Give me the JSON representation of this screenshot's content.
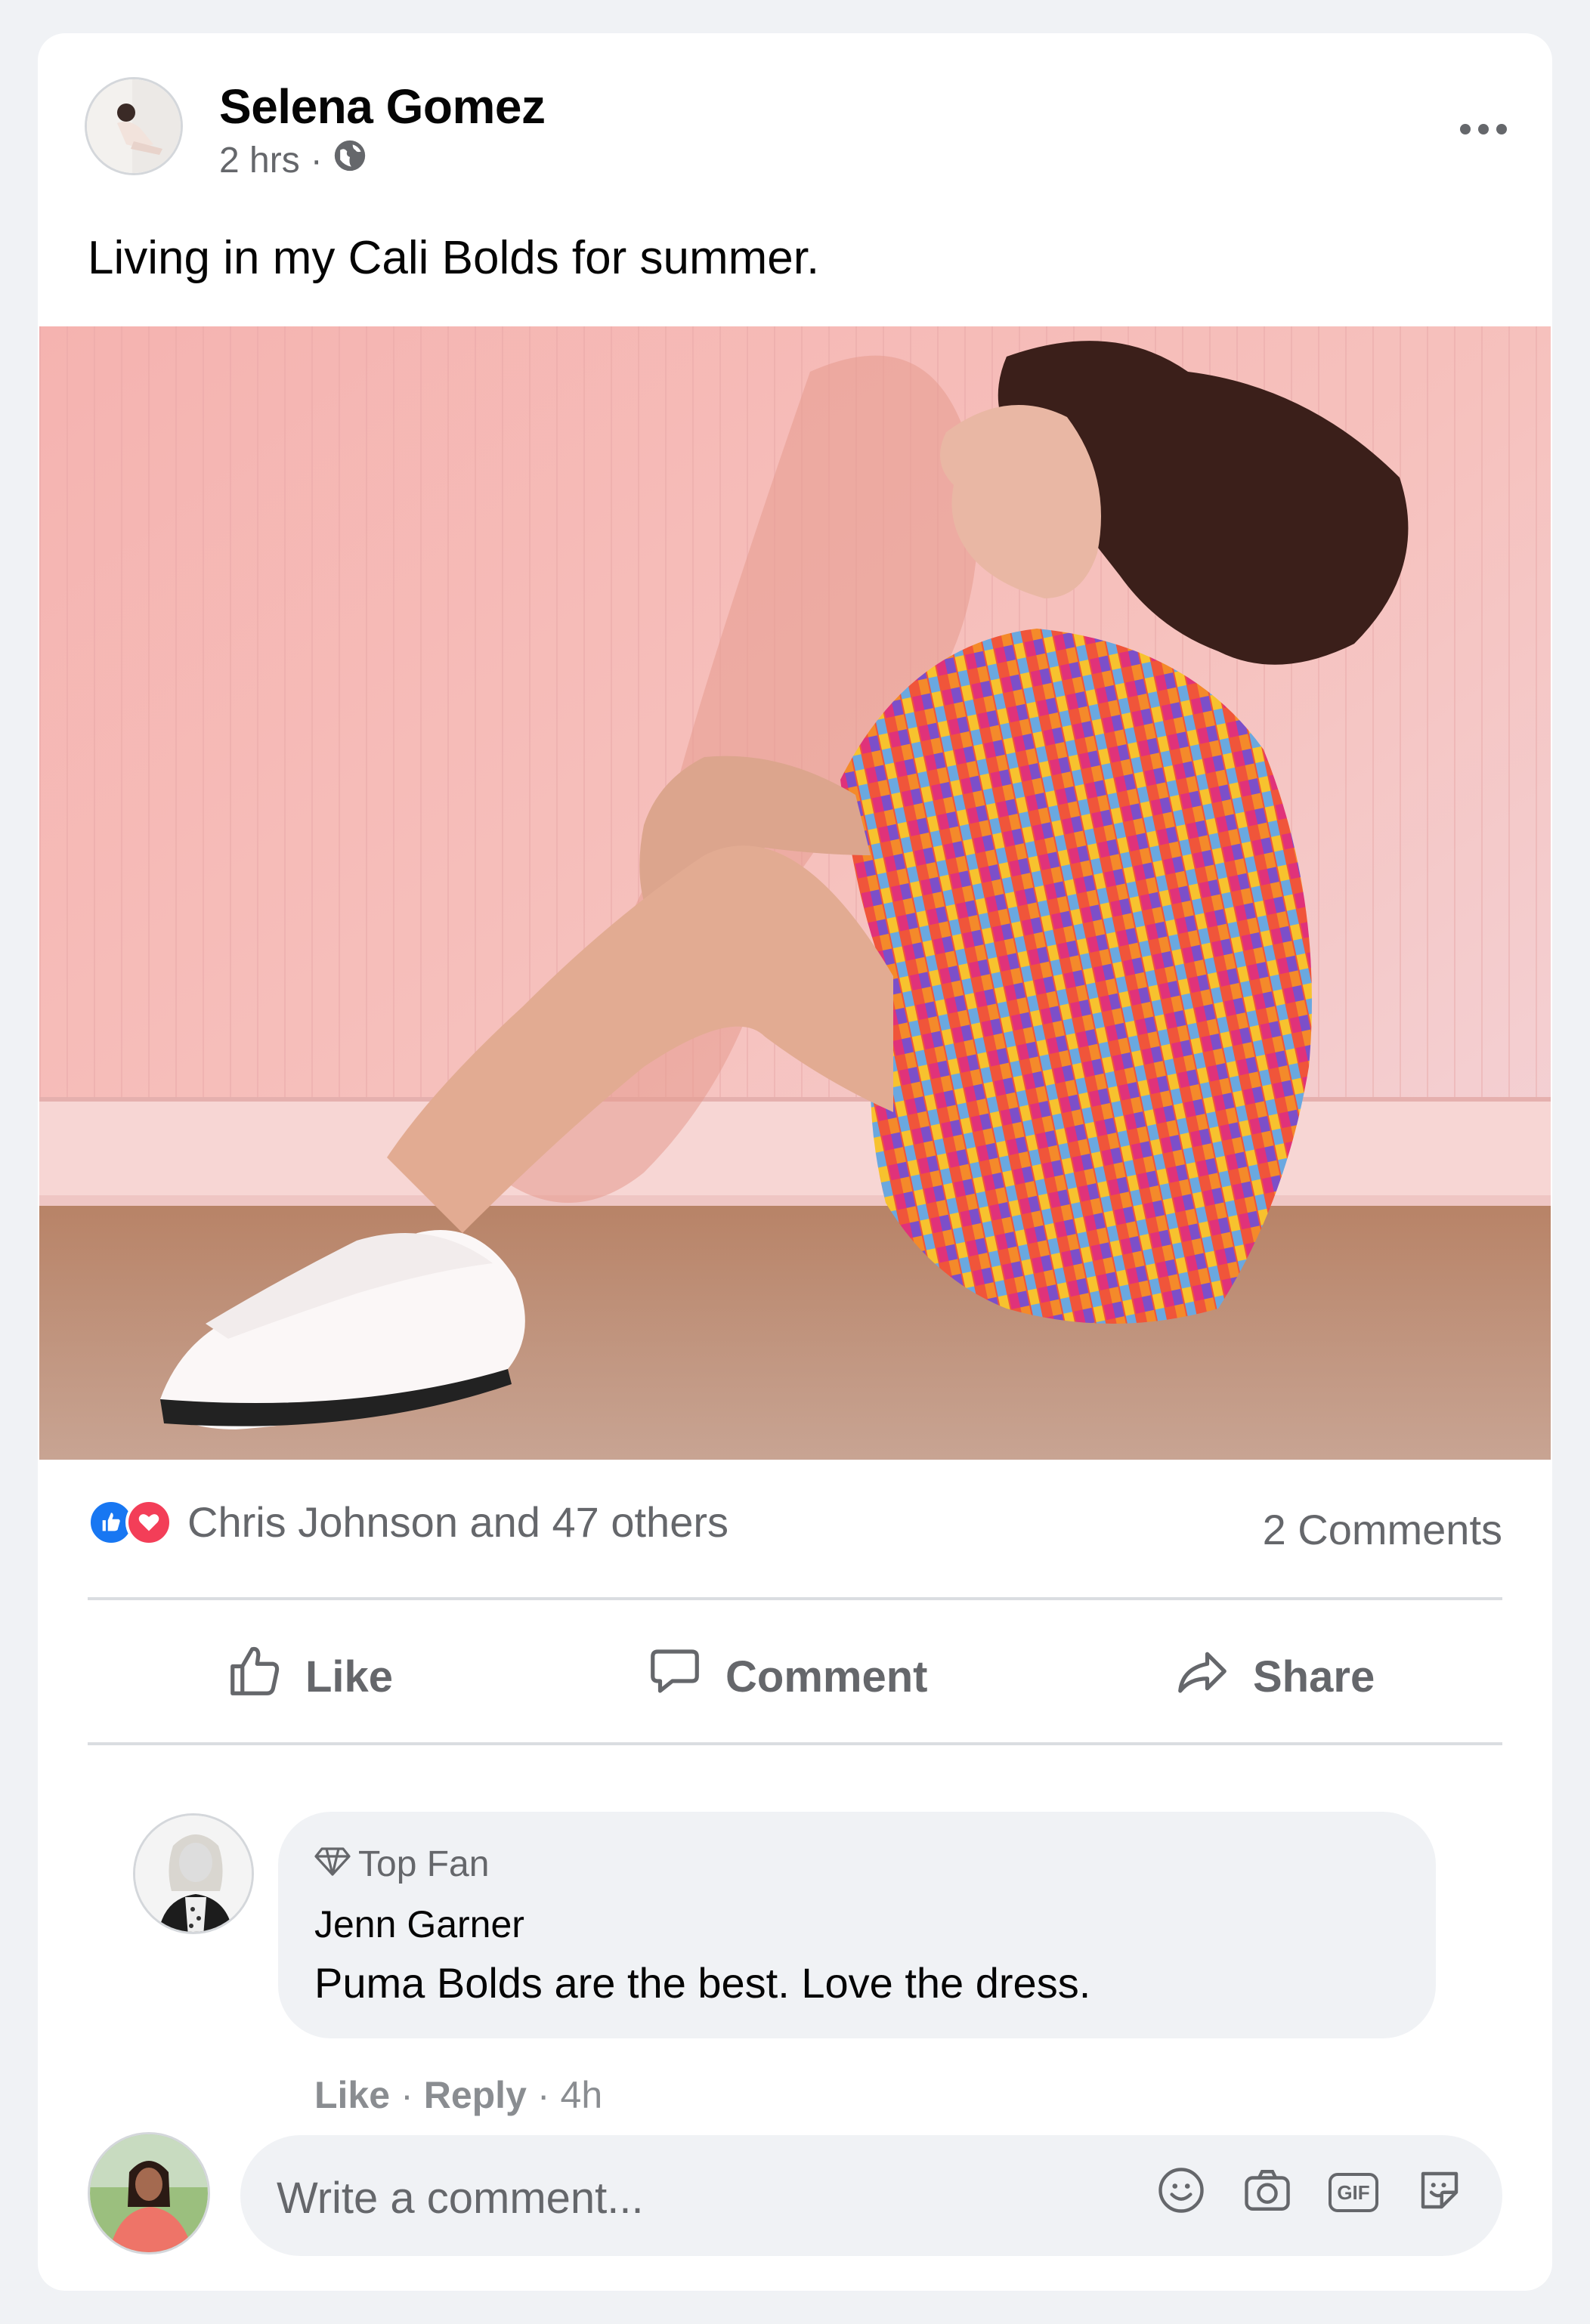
{
  "post": {
    "author": "Selena Gomez",
    "time": "2 hrs",
    "separator": "·",
    "visibility_icon": "globe-icon",
    "text": "Living in my Cali Bolds for summer.",
    "reactions_text": "Chris Johnson and 47 others",
    "comments_count": "2 Comments",
    "colors": {
      "like_blue": "#1877f2",
      "love_red": "#f33e58",
      "secondary_text": "#65676b",
      "card_bg": "#ffffff",
      "page_bg": "#f0f2f5"
    }
  },
  "actions": {
    "like": "Like",
    "comment": "Comment",
    "share": "Share"
  },
  "comment": {
    "badge": "Top Fan",
    "badge_icon": "diamond-icon",
    "author": "Jenn Garner",
    "text": "Puma Bolds are the best. Love the dress.",
    "like": "Like",
    "reply": "Reply",
    "sep": "·",
    "time": "4h"
  },
  "composer": {
    "placeholder": "Write a comment...",
    "icons": [
      "smiley-icon",
      "camera-icon",
      "gif-icon",
      "sticker-icon"
    ],
    "gif_label": "GIF"
  }
}
